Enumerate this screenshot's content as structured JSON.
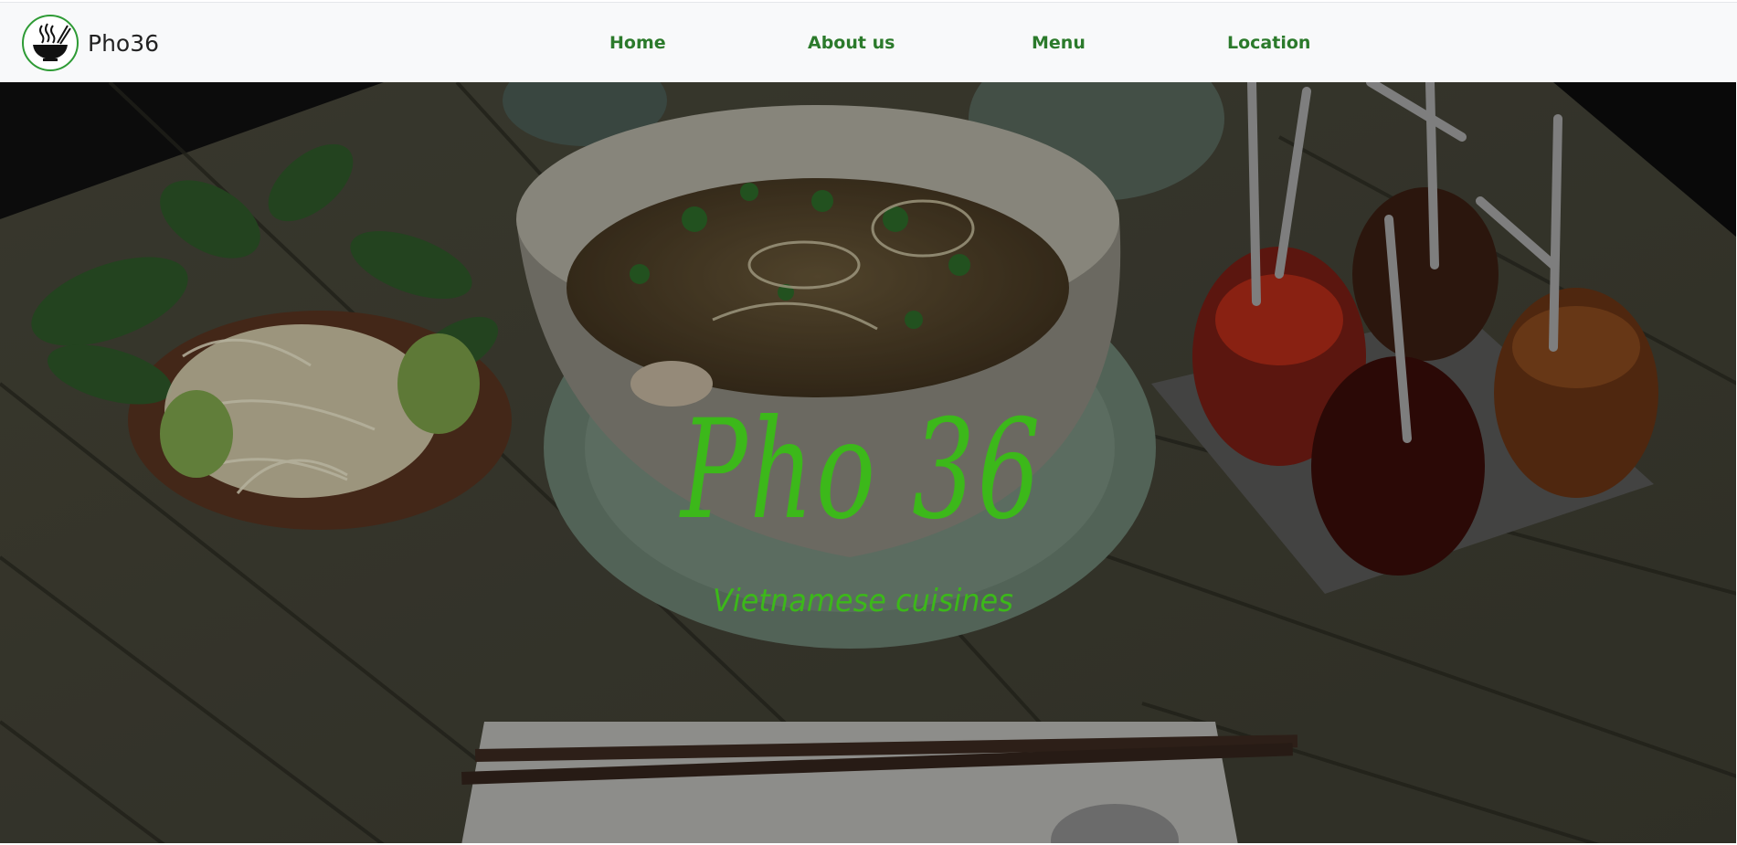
{
  "brand": {
    "name": "Pho36",
    "logo_icon": "pho-bowl-icon"
  },
  "nav": {
    "items": [
      {
        "label": "Home"
      },
      {
        "label": "About us"
      },
      {
        "label": "Menu"
      },
      {
        "label": "Location"
      }
    ]
  },
  "hero": {
    "title": "Pho 36",
    "subtitle": "Vietnamese cuisines",
    "image": "pho-bowl-photo"
  },
  "colors": {
    "accent_green": "#3cb81a",
    "nav_green": "#2b7a2b",
    "navbar_bg": "#f8f9fa"
  }
}
